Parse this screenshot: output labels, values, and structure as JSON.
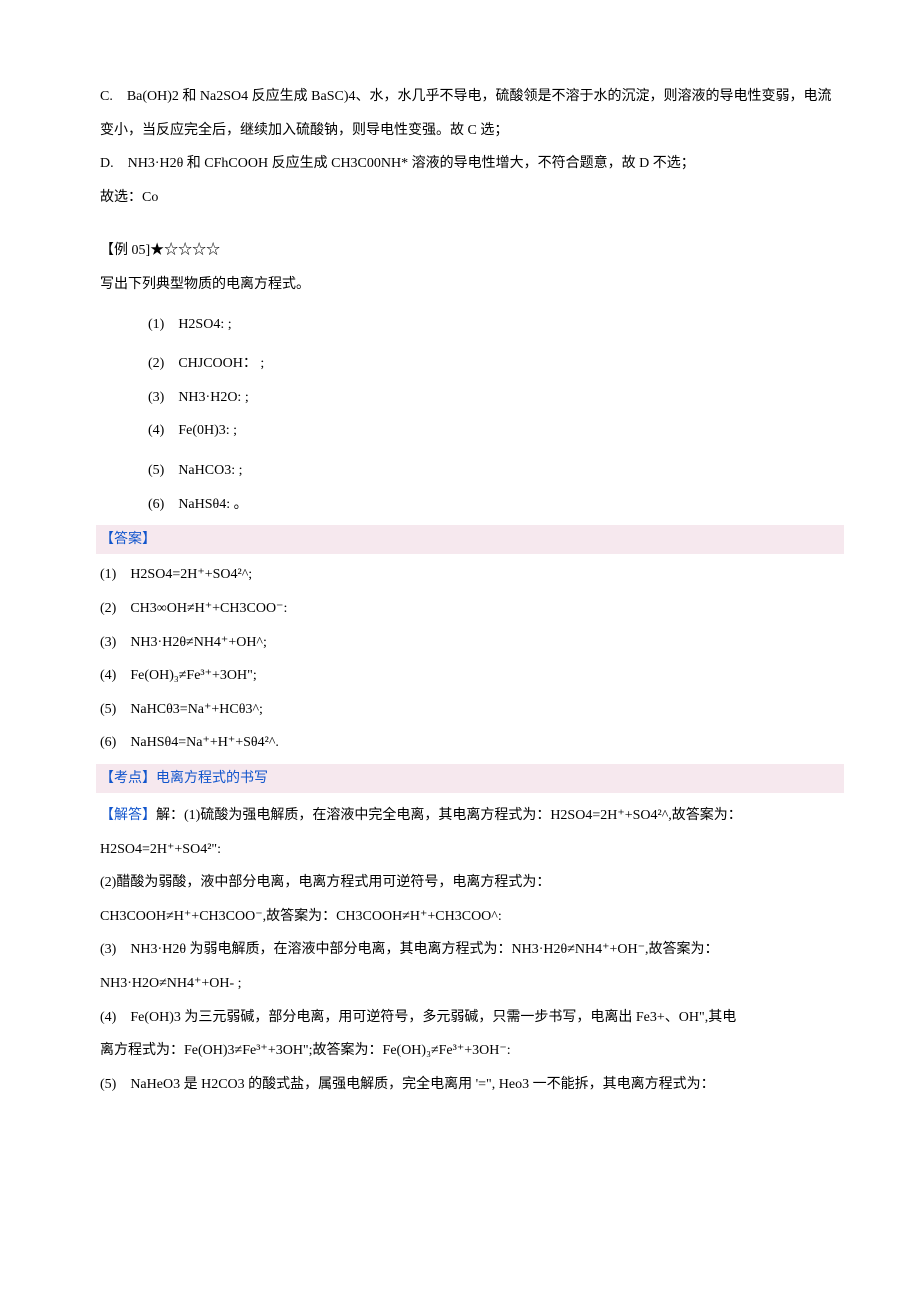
{
  "optionC": "C.　Ba(OH)2 和 Na2SO4 反应生成 BaSC)4、水，水几乎不导电，硫酸领是不溶于水的沉淀，则溶液的导电性变弱，电流变小，当反应完全后，继续加入硫酸钠，则导电性变强。故 C 选；",
  "optionD": "D.　NH3·H2θ 和 CFhCOOH 反应生成 CH3C00NH* 溶液的导电性增大，不符合题意，故 D 不选；",
  "therefore": "故选：Co",
  "example05_header": "【例 05]★☆☆☆☆",
  "example05_prompt": "写出下列典型物质的电离方程式。",
  "q1": "(1)　H2SO4:  ;",
  "q2": "(2)　CHJCOOH： ;",
  "q3": "(3)　NH3·H2O: ;",
  "q4": "(4)　Fe(0H)3: ;",
  "q5": "(5)　NaHCO3: ;",
  "q6": "(6)　NaHSθ4: 。",
  "answer_label": "【答案】",
  "a1": "(1)　H2SO4=2H⁺+SO4²^;",
  "a2": "(2)　CH3∞OH≠H⁺+CH3COO⁻:",
  "a3": "(3)　NH3·H2θ≠NH4⁺+OH^;",
  "a4": "(4)　Fe(OH)₃≠Fe³⁺+3OH\";",
  "a5": "(5)　NaHCθ3=Na⁺+HCθ3^;",
  "a6": "(6)　NaHSθ4=Na⁺+H⁺+Sθ4²^.",
  "kaodian_label": "【考点】",
  "kaodian_text": "电离方程式的书写",
  "jieda_label": "【解答】",
  "jieda_1a": "解：(1)硫酸为强电解质，在溶液中完全电离，其电离方程式为：H2SO4=2H⁺+SO4²^,故答案为：",
  "jieda_1b": "H2SO4=2H⁺+SO4²\":",
  "jieda_2a": "(2)醋酸为弱酸，液中部分电离，电离方程式用可逆符号，电离方程式为：",
  "jieda_2b": "CH3COOH≠H⁺+CH3COO⁻,故答案为：CH3COOH≠H⁺+CH3COO^:",
  "jieda_3a": "(3)　NH3·H2θ 为弱电解质，在溶液中部分电离，其电离方程式为：NH3·H2θ≠NH4⁺+OH⁻,故答案为：",
  "jieda_3b": "NH3·H2O≠NH4⁺+OH- ;",
  "jieda_4a": "(4)　Fe(OH)3 为三元弱碱，部分电离，用可逆符号，多元弱碱，只需一步书写，电离出 Fe3+、OH\",其电",
  "jieda_4b": "离方程式为：Fe(OH)3≠Fe³⁺+3OH\";故答案为：Fe(OH)₃≠Fe³⁺+3OH⁻:",
  "jieda_5": "(5)　NaHeO3 是 H2CO3 的酸式盐，属强电解质，完全电离用 '᠍=\", Heo3 一不能拆，其电离方程式为："
}
